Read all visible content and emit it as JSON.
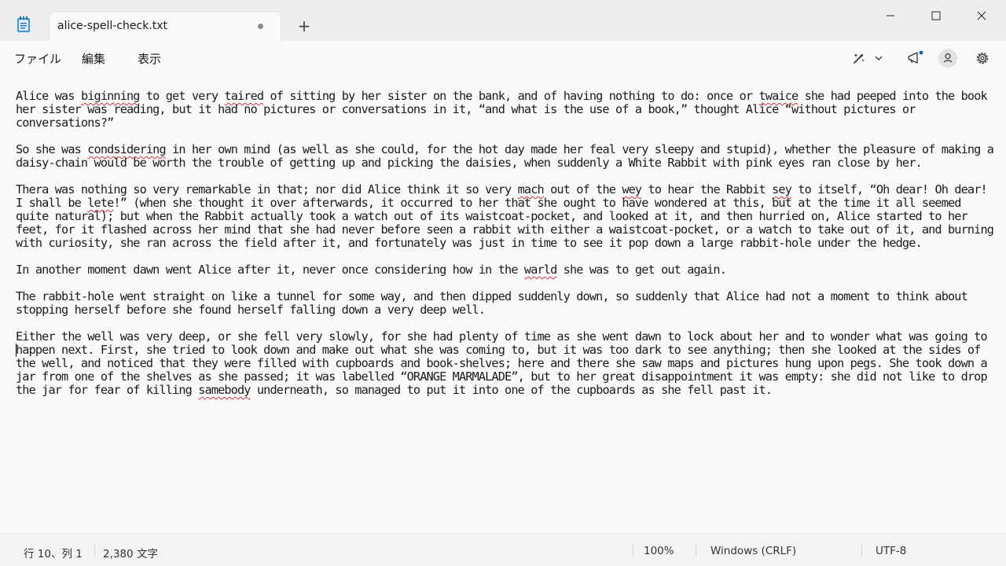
{
  "tab": {
    "title": "alice-spell-check.txt",
    "new_tab_label": "+"
  },
  "menu": {
    "file": "ファイル",
    "edit": "編集",
    "view": "表示"
  },
  "toolbar": {
    "icons": [
      "copilot-icon",
      "chevron-down-icon",
      "feedback-icon",
      "account-icon",
      "settings-icon"
    ]
  },
  "document": {
    "paragraphs": [
      {
        "segments": [
          {
            "t": "Alice was "
          },
          {
            "t": "biginning",
            "err": true
          },
          {
            "t": " to get very "
          },
          {
            "t": "taired",
            "err": true
          },
          {
            "t": " of sitting by her sister on the bank, and of having nothing to do: once or "
          },
          {
            "t": "twaice",
            "err": true
          },
          {
            "t": " she had peeped into the book her sister was reading, but it had no pictures or conversations in it, “and what is the use of a book,” thought Alice “without pictures or conversations?”"
          }
        ]
      },
      {
        "segments": [
          {
            "t": "So she was "
          },
          {
            "t": "condsidering",
            "err": true
          },
          {
            "t": " in her own mind (as well as she could, for the hot day made her feal very sleepy and stupid), whether the pleasure of making a daisy-chain would be worth the trouble of getting up and picking the daisies, when suddenly a White Rabbit with pink eyes ran close by her."
          }
        ]
      },
      {
        "segments": [
          {
            "t": "Thera was nothing so very remarkable in that; nor did Alice think it so very "
          },
          {
            "t": "mach",
            "err": true
          },
          {
            "t": " out of the "
          },
          {
            "t": "wey",
            "err": true
          },
          {
            "t": " to hear the Rabbit "
          },
          {
            "t": "sey",
            "err": true
          },
          {
            "t": " to itself, “Oh dear! Oh dear! I shall be "
          },
          {
            "t": "lete",
            "err": true
          },
          {
            "t": "!” (when she thought it over afterwards, it occurred to her that she ought to have wondered at this, but at the time it all seemed quite natural); but when the Rabbit actually took a watch out of its waistcoat-pocket, and looked at it, and then hurried on, Alice started to her feet, for it flashed across her mind that she had never before seen a rabbit with either a waistcoat-pocket, or a watch to take out of it, and burning with curiosity, she ran across the field after it, and fortunately was just in time to see it pop down a large rabbit-hole under the hedge."
          }
        ]
      },
      {
        "segments": [
          {
            "t": "In another moment dawn went Alice after it, never once considering how in the "
          },
          {
            "t": "warld",
            "err": true
          },
          {
            "t": " she was to get out again."
          }
        ]
      },
      {
        "segments": [
          {
            "t": "The rabbit-hole went straight on like a tunnel for some way, and then dipped suddenly down, so suddenly that Alice had not a moment to think about stopping herself before she found herself falling down a very deep well."
          }
        ]
      },
      {
        "segments": [
          {
            "t": "Either the well was very deep, or she fell very slowly, for she had plenty of time as she went dawn to lock about her and to wonder what was going to happen next. First, she tried to look down and make out what she was coming to, but it was too dark to see anything; then she looked at the sides of the well, and noticed that they were filled with cupboards and book-shelves; here and there she saw maps and pictures hung upon pegs. She took down a jar from one of the shelves as she passed; it was labelled “ORANGE MARMALADE”, but to her great disappointment it was empty: she did not like to drop the jar for fear of killing "
          },
          {
            "t": "samebody",
            "err": true
          },
          {
            "t": " underneath, so managed to put it into one of the cupboards as she fell past it."
          }
        ]
      }
    ],
    "caret_after_paragraph": 4
  },
  "status": {
    "position": "行 10、列 1",
    "chars": "2,380 文字",
    "zoom": "100%",
    "line_ending": "Windows (CRLF)",
    "encoding": "UTF-8"
  },
  "colors": {
    "spell_error": "#d13438",
    "accent": "#0067c0"
  }
}
